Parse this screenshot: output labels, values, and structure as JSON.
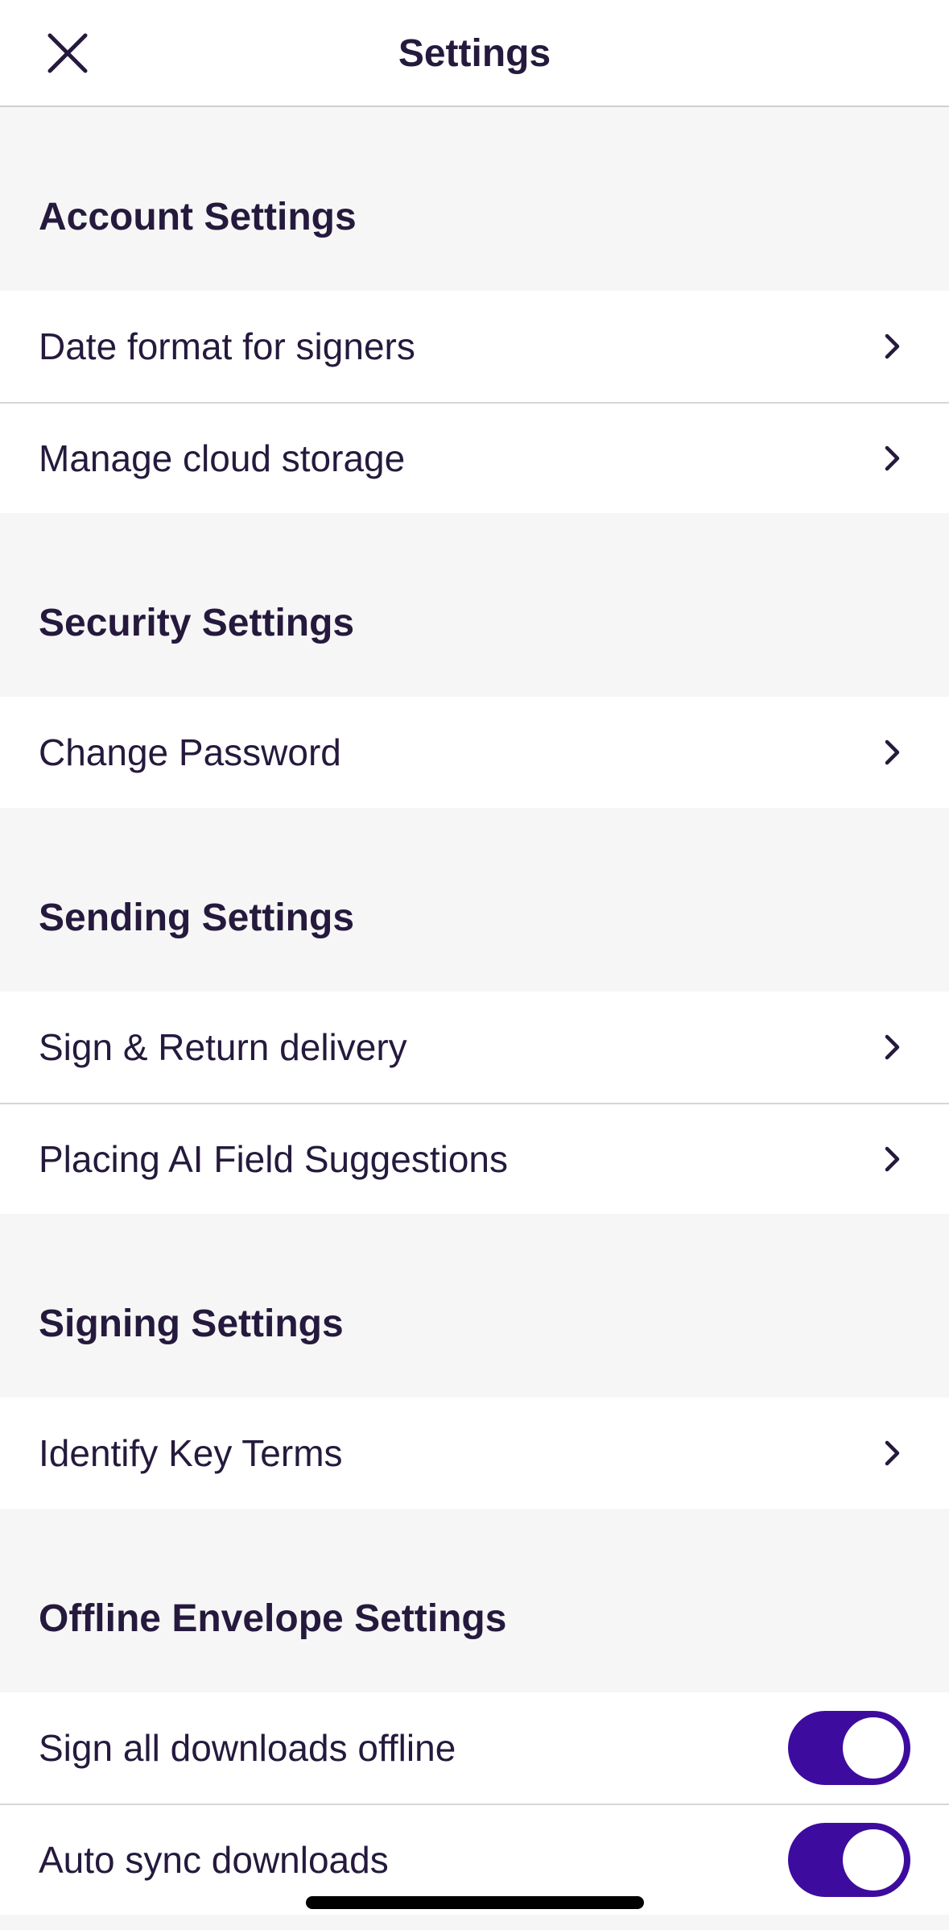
{
  "header": {
    "title": "Settings",
    "close_icon": "close-icon"
  },
  "sections": {
    "account": {
      "title": "Account Settings",
      "items": [
        {
          "label": "Date format for signers",
          "icon": "chevron-right-icon"
        },
        {
          "label": "Manage cloud storage",
          "icon": "chevron-right-icon"
        }
      ]
    },
    "security": {
      "title": "Security Settings",
      "items": [
        {
          "label": "Change Password",
          "icon": "chevron-right-icon"
        }
      ]
    },
    "sending": {
      "title": "Sending Settings",
      "items": [
        {
          "label": "Sign & Return delivery",
          "icon": "chevron-right-icon"
        },
        {
          "label": "Placing AI Field Suggestions",
          "icon": "chevron-right-icon"
        }
      ]
    },
    "signing": {
      "title": "Signing Settings",
      "items": [
        {
          "label": "Identify Key Terms",
          "icon": "chevron-right-icon"
        }
      ]
    },
    "offline": {
      "title": "Offline Envelope Settings",
      "items": [
        {
          "label": "Sign all downloads offline",
          "toggle_on": true
        },
        {
          "label": "Auto sync downloads",
          "toggle_on": true
        }
      ]
    }
  },
  "colors": {
    "text": "#251a3d",
    "accent": "#3d0c9e",
    "background": "#f6f6f6",
    "row_background": "#ffffff",
    "divider": "#d6d6da"
  }
}
